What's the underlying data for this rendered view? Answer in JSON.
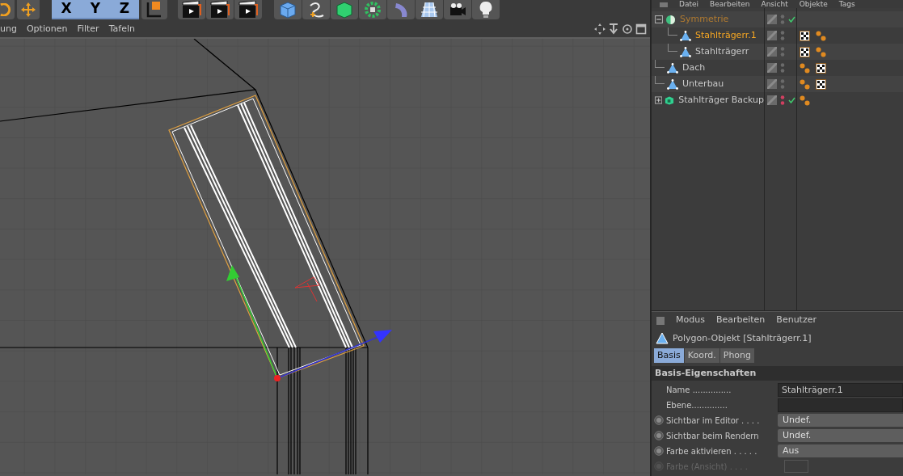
{
  "toolbar": {
    "axis_locks": [
      {
        "label": "X",
        "on": true
      },
      {
        "label": "Y",
        "on": true
      },
      {
        "label": "Z",
        "on": true
      }
    ]
  },
  "viewport_menu": [
    "ung",
    "Optionen",
    "Filter",
    "Tafeln"
  ],
  "object_manager": {
    "menu": [
      "Datei",
      "Bearbeiten",
      "Ansicht",
      "Objekte",
      "Tags"
    ],
    "objects": [
      {
        "name": "Symmetrie",
        "kind": "symmetry",
        "selected": false,
        "contains_selected": true,
        "expanded": true,
        "hidden": false,
        "enabled_check": true,
        "children": [
          {
            "name": "Stahlträgerr.1",
            "kind": "polygon",
            "selected": true,
            "contains_selected": false,
            "hidden": false,
            "enabled_check": false,
            "tags": [
              {
                "kind": "texture"
              },
              {
                "kind": "phong"
              }
            ]
          },
          {
            "name": "Stahlträgerr",
            "kind": "polygon",
            "selected": false,
            "contains_selected": false,
            "hidden": false,
            "enabled_check": false,
            "tags": [
              {
                "kind": "texture"
              },
              {
                "kind": "phong"
              }
            ]
          }
        ]
      },
      {
        "name": "Dach",
        "kind": "polygon",
        "selected": false,
        "contains_selected": false,
        "hidden": false,
        "enabled_check": false,
        "tags": [
          {
            "kind": "phong"
          },
          {
            "kind": "texture"
          }
        ]
      },
      {
        "name": "Unterbau",
        "kind": "polygon",
        "selected": false,
        "contains_selected": false,
        "hidden": false,
        "enabled_check": false,
        "tags": [
          {
            "kind": "phong"
          },
          {
            "kind": "texture"
          }
        ]
      },
      {
        "name": "Stahlträger Backup",
        "kind": "null",
        "selected": false,
        "contains_selected": false,
        "expanded": false,
        "hidden": true,
        "enabled_check": true,
        "tags": [
          {
            "kind": "phong"
          }
        ]
      }
    ]
  },
  "attribute_manager": {
    "menu": [
      "Modus",
      "Bearbeiten",
      "Benutzer"
    ],
    "title": "Polygon-Objekt [Stahlträgerr.1]",
    "tabs": [
      {
        "label": "Basis",
        "selected": true
      },
      {
        "label": "Koord.",
        "selected": false
      },
      {
        "label": "Phong",
        "selected": false
      }
    ],
    "section": "Basis-Eigenschaften",
    "fields": [
      {
        "kind": "text",
        "label": "Name ...............",
        "value": "Stahlträgerr.1",
        "animatable": false,
        "disabled": false
      },
      {
        "kind": "text",
        "label": "Ebene..............",
        "animatable": false,
        "disabled": false
      },
      {
        "kind": "dropdown",
        "label": "Sichtbar im Editor . . . .",
        "value": "Undef.",
        "animatable": true,
        "disabled": false
      },
      {
        "kind": "dropdown",
        "label": "Sichtbar beim Rendern",
        "value": "Undef.",
        "animatable": true,
        "disabled": false
      },
      {
        "kind": "dropdown",
        "label": "Farbe aktivieren . . . . .",
        "value": "Aus",
        "animatable": true,
        "disabled": false
      },
      {
        "kind": "color",
        "label": "Farbe (Ansicht) . . . .",
        "animatable": true,
        "disabled": true
      }
    ]
  }
}
